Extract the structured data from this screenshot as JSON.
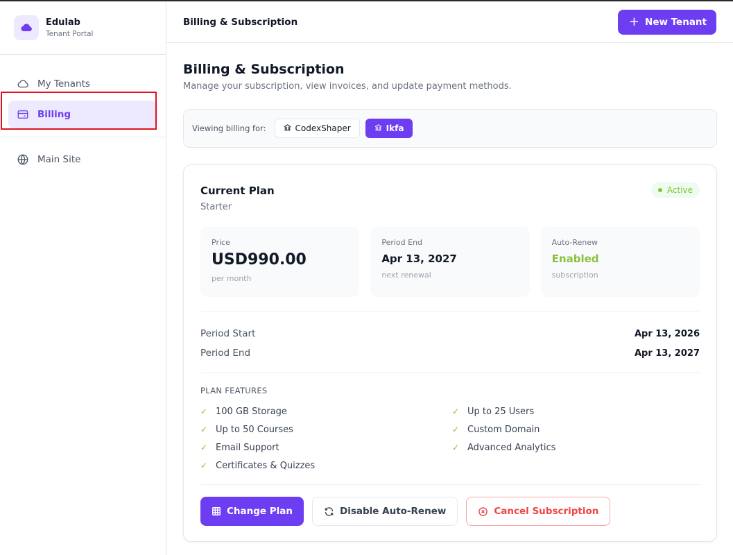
{
  "brand": {
    "name": "Edulab",
    "subtitle": "Tenant Portal"
  },
  "sidebar": {
    "items": [
      {
        "label": "My Tenants",
        "icon": "cloud-icon",
        "active": false
      },
      {
        "label": "Billing",
        "icon": "credit-card-icon",
        "active": true
      },
      {
        "label": "Main Site",
        "icon": "globe-icon",
        "active": false
      }
    ]
  },
  "header": {
    "title": "Billing & Subscription",
    "new_tenant_label": "New Tenant"
  },
  "page": {
    "title": "Billing & Subscription",
    "subtitle": "Manage your subscription, view invoices, and update payment methods."
  },
  "tenant_selector": {
    "label": "Viewing billing for:",
    "tenants": [
      {
        "name": "CodexShaper",
        "selected": false
      },
      {
        "name": "Ikfa",
        "selected": true
      }
    ]
  },
  "plan": {
    "title": "Current Plan",
    "name": "Starter",
    "status": "Active",
    "stats": {
      "price": {
        "label": "Price",
        "value": "USD990.00",
        "sub": "per month"
      },
      "period_end": {
        "label": "Period End",
        "value": "Apr 13, 2027",
        "sub": "next renewal"
      },
      "auto_renew": {
        "label": "Auto-Renew",
        "value": "Enabled",
        "sub": "subscription"
      }
    },
    "period_start_label": "Period Start",
    "period_start_value": "Apr 13, 2026",
    "period_end_label": "Period End",
    "period_end_value": "Apr 13, 2027",
    "features_title": "PLAN FEATURES",
    "features": [
      "100 GB Storage",
      "Up to 25 Users",
      "Up to 50 Courses",
      "Custom Domain",
      "Email Support",
      "Advanced Analytics",
      "Certificates & Quizzes"
    ]
  },
  "actions": {
    "change_plan": "Change Plan",
    "disable_auto_renew": "Disable Auto-Renew",
    "cancel_subscription": "Cancel Subscription"
  },
  "colors": {
    "accent": "#6d3df2",
    "success": "#86c23a",
    "danger": "#ef4444"
  }
}
